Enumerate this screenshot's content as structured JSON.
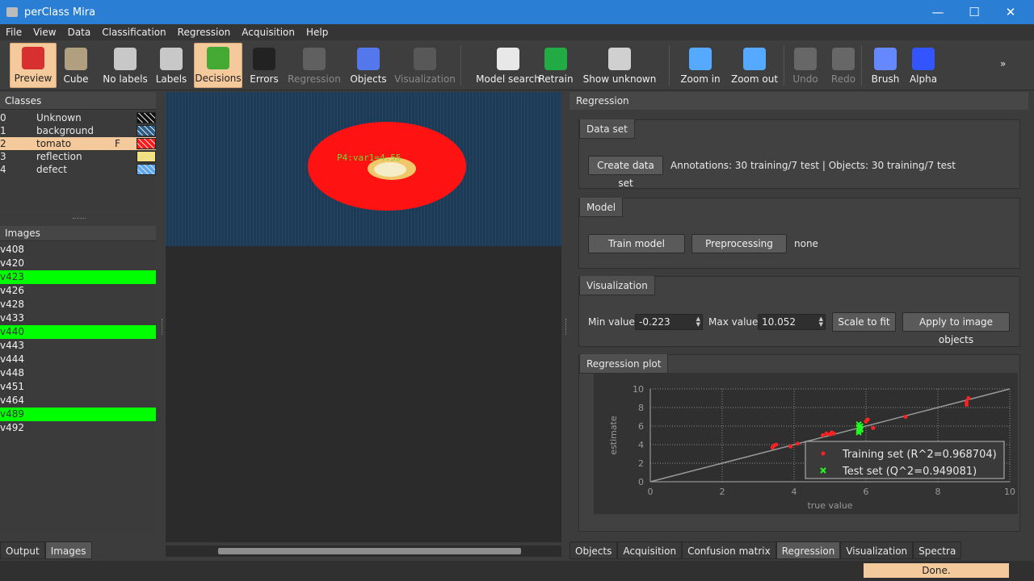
{
  "window": {
    "title": "perClass Mira",
    "minimize": "—",
    "maximize": "☐",
    "close": "✕"
  },
  "menu": [
    "File",
    "View",
    "Data",
    "Classification",
    "Regression",
    "Acquisition",
    "Help"
  ],
  "toolbar": {
    "items": [
      {
        "label": "Preview",
        "icon": "tomato-preview-icon",
        "state": "active"
      },
      {
        "label": "Cube",
        "icon": "cube-icon",
        "state": "normal"
      },
      {
        "label": "No labels",
        "icon": "no-labels-icon",
        "state": "normal"
      },
      {
        "label": "Labels",
        "icon": "labels-icon",
        "state": "normal"
      },
      {
        "label": "Decisions",
        "icon": "decisions-icon",
        "state": "active"
      },
      {
        "label": "Errors",
        "icon": "errors-icon",
        "state": "normal"
      },
      {
        "label": "Regression",
        "icon": "regression-icon",
        "state": "disabled"
      },
      {
        "label": "Objects",
        "icon": "objects-icon",
        "state": "normal"
      },
      {
        "label": "Visualization",
        "icon": "visualization-icon",
        "state": "disabled"
      },
      {
        "label": "Model search",
        "icon": "model-search-icon",
        "state": "normal"
      },
      {
        "label": "Retrain",
        "icon": "retrain-icon",
        "state": "normal"
      },
      {
        "label": "Show unknown",
        "icon": "show-unknown-icon",
        "state": "normal"
      },
      {
        "label": "Zoom in",
        "icon": "zoom-in-icon",
        "state": "normal"
      },
      {
        "label": "Zoom out",
        "icon": "zoom-out-icon",
        "state": "normal"
      },
      {
        "label": "Undo",
        "icon": "undo-icon",
        "state": "disabled"
      },
      {
        "label": "Redo",
        "icon": "redo-icon",
        "state": "disabled"
      },
      {
        "label": "Brush",
        "icon": "brush-icon",
        "state": "normal"
      },
      {
        "label": "Alpha",
        "icon": "alpha-icon",
        "state": "normal"
      }
    ],
    "overflow": "»"
  },
  "classes": {
    "header": "Classes",
    "items": [
      {
        "idx": "0",
        "name": "Unknown",
        "flag": "",
        "color": "#111111"
      },
      {
        "idx": "1",
        "name": "background",
        "flag": "",
        "color": "#2b5f8a"
      },
      {
        "idx": "2",
        "name": "tomato",
        "flag": "F",
        "color": "#ff1a1a"
      },
      {
        "idx": "3",
        "name": "reflection",
        "flag": "",
        "color": "#f5e26a"
      },
      {
        "idx": "4",
        "name": "defect",
        "flag": "",
        "color": "#5aa8f0"
      }
    ]
  },
  "images": {
    "header": "Images",
    "items": [
      {
        "name": "v408",
        "highlight": false
      },
      {
        "name": "v420",
        "highlight": false
      },
      {
        "name": "v423",
        "highlight": true
      },
      {
        "name": "v426",
        "highlight": false
      },
      {
        "name": "v428",
        "highlight": false
      },
      {
        "name": "v433",
        "highlight": false
      },
      {
        "name": "v440",
        "highlight": true
      },
      {
        "name": "v443",
        "highlight": false
      },
      {
        "name": "v444",
        "highlight": false
      },
      {
        "name": "v448",
        "highlight": false
      },
      {
        "name": "v451",
        "highlight": false
      },
      {
        "name": "v464",
        "highlight": false
      },
      {
        "name": "v489",
        "highlight": true
      },
      {
        "name": "v492",
        "highlight": false
      }
    ]
  },
  "left_tabs": [
    {
      "label": "Output",
      "current": false
    },
    {
      "label": "Images",
      "current": true
    }
  ],
  "image_view": {
    "annotation": "P4:var1=4.55"
  },
  "regression": {
    "header": "Regression",
    "dataset": {
      "title": "Data set",
      "button": "Create data set",
      "info": "Annotations: 30 training/7 test | Objects: 30 training/7 test"
    },
    "model": {
      "title": "Model",
      "train_button": "Train model",
      "preprocessing_button": "Preprocessing",
      "preprocessing_value": "none"
    },
    "visualization": {
      "title": "Visualization",
      "min_label": "Min value",
      "min_value": "-0.223",
      "max_label": "Max value",
      "max_value": "10.052",
      "scale_button": "Scale to fit",
      "apply_button": "Apply to image objects"
    },
    "plot": {
      "title": "Regression plot"
    }
  },
  "chart_data": {
    "type": "scatter",
    "title": "",
    "xlabel": "true value",
    "ylabel": "estimate",
    "xlim": [
      0,
      10
    ],
    "ylim": [
      0,
      10
    ],
    "xticks": [
      "0",
      "2",
      "4",
      "6",
      "8",
      "10"
    ],
    "yticks": [
      "0",
      "2",
      "4",
      "6",
      "8",
      "10"
    ],
    "grid": true,
    "legend_position": "center-right",
    "fit_line": {
      "x": [
        0,
        10
      ],
      "y": [
        -0.2,
        10
      ]
    },
    "series": [
      {
        "name": "Training set (R^2=0.968704)",
        "marker": "dot",
        "color": "#ff2020",
        "x": [
          3.4,
          3.45,
          3.5,
          3.9,
          4.1,
          4.8,
          4.9,
          5.0,
          5.05,
          5.1,
          5.8,
          6.0,
          6.05,
          6.2,
          7.1,
          8.8,
          8.8,
          8.85
        ],
        "y": [
          3.7,
          3.9,
          4.0,
          3.8,
          4.1,
          5.0,
          5.2,
          5.1,
          5.3,
          5.2,
          5.9,
          6.5,
          6.7,
          5.8,
          7.0,
          8.3,
          8.6,
          9.0
        ]
      },
      {
        "name": "Test set (Q^2=0.949081)",
        "marker": "x",
        "color": "#20ff20",
        "x": [
          5.8,
          5.8,
          5.85,
          5.8,
          5.85,
          5.8,
          5.85
        ],
        "y": [
          5.3,
          5.5,
          5.7,
          5.9,
          6.0,
          6.2,
          5.6
        ]
      }
    ]
  },
  "bottom_tabs": [
    {
      "label": "Objects",
      "current": false
    },
    {
      "label": "Acquisition",
      "current": false
    },
    {
      "label": "Confusion matrix",
      "current": false
    },
    {
      "label": "Regression",
      "current": true
    },
    {
      "label": "Visualization",
      "current": false
    },
    {
      "label": "Spectra",
      "current": false
    }
  ],
  "status": "Done."
}
